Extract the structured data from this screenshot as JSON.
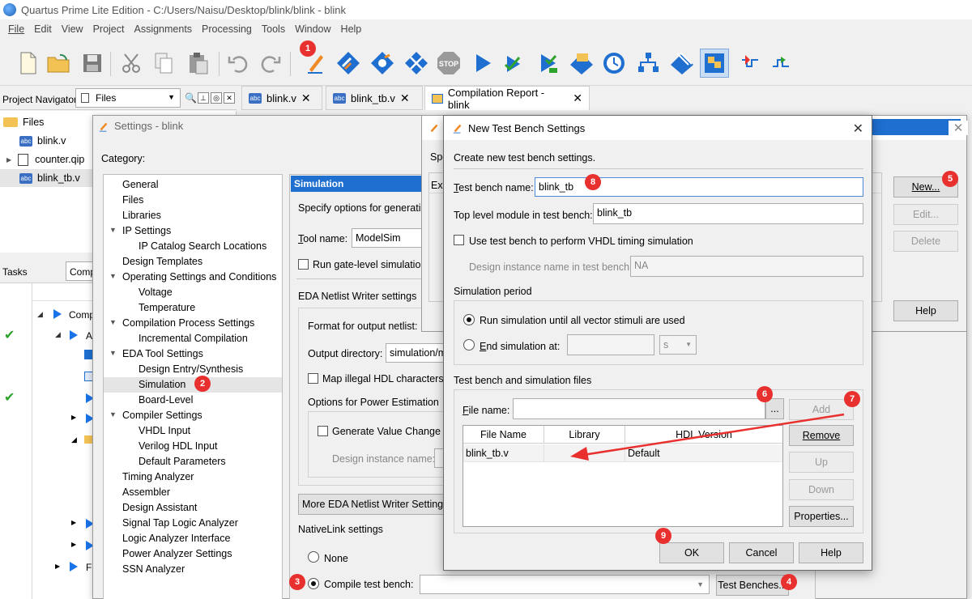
{
  "window": {
    "title": "Quartus Prime Lite Edition - C:/Users/Naisu/Desktop/blink/blink - blink"
  },
  "menu": [
    "File",
    "Edit",
    "View",
    "Project",
    "Assignments",
    "Processing",
    "Tools",
    "Window",
    "Help"
  ],
  "toolbar": {
    "icons": [
      "new-file-icon",
      "open-folder-icon",
      "save-icon",
      "cut-icon",
      "copy-icon",
      "paste-icon",
      "undo-icon",
      "redo-icon",
      "settings-pencil-icon",
      "analysis-icon",
      "compile-design-icon",
      "fitter-icon",
      "stop-icon",
      "start-icon",
      "check-icon",
      "start-analysis-icon",
      "assembler-icon",
      "timing-icon",
      "netlist-icon",
      "programmer-icon",
      "chip-planner-icon",
      "signal-tap-icon",
      "simulate-icon"
    ],
    "stop_label": "STOP"
  },
  "navigator": {
    "title": "Project Navigator",
    "view": "Files",
    "files": [
      {
        "name": "Files",
        "type": "folder"
      },
      {
        "name": "blink.v",
        "type": "abc"
      },
      {
        "name": "counter.qip",
        "type": "qip"
      },
      {
        "name": "blink_tb.v",
        "type": "abc"
      }
    ],
    "abc_label": "abc"
  },
  "tasks": {
    "label": "Tasks",
    "combo": "Comp",
    "rows": [
      "Comp",
      "A",
      "F"
    ]
  },
  "tabs": [
    {
      "label": "blink.v"
    },
    {
      "label": "blink_tb.v"
    },
    {
      "label": "Compilation Report - blink"
    }
  ],
  "settings": {
    "title": "Settings - blink",
    "category_label": "Category:",
    "categories": [
      "General",
      "Files",
      "Libraries",
      "IP Settings",
      "IP Catalog Search Locations",
      "Design Templates",
      "Operating Settings and Conditions",
      "Voltage",
      "Temperature",
      "Compilation Process Settings",
      "Incremental Compilation",
      "EDA Tool Settings",
      "Design Entry/Synthesis",
      "Simulation",
      "Board-Level",
      "Compiler Settings",
      "VHDL Input",
      "Verilog HDL Input",
      "Default Parameters",
      "Timing Analyzer",
      "Assembler",
      "Design Assistant",
      "Signal Tap Logic Analyzer",
      "Logic Analyzer Interface",
      "Power Analyzer Settings",
      "SSN Analyzer"
    ],
    "panel": {
      "header": "Simulation",
      "specify": "Specify options for generatin",
      "tool_name_label": "Tool name:",
      "tool_name": "ModelSim",
      "run_gate": "Run gate-level simulation",
      "eda_netlist": "EDA Netlist Writer settings",
      "format_label": "Format for output netlist:",
      "output_dir_label": "Output directory:",
      "output_dir": "simulation/m",
      "map_illegal": "Map illegal HDL characters",
      "power_est": "Options for Power Estimation",
      "gen_vcd": "Generate Value Change Du",
      "design_inst": "Design instance name:",
      "more_eda": "More EDA Netlist Writer Settings...",
      "nativelink": "NativeLink settings",
      "none": "None",
      "compile_tb": "Compile test bench:",
      "test_benches": "Test Benches..."
    }
  },
  "tb_list": {
    "spec": "Spe",
    "exi": "Exi",
    "new": "New...",
    "edit": "Edit...",
    "delete": "Delete",
    "help": "Help"
  },
  "ntb": {
    "title": "New Test Bench Settings",
    "intro": "Create new test bench settings.",
    "name_label": "Test bench name:",
    "name": "blink_tb",
    "top_label": "Top level module in test bench:",
    "top": "blink_tb",
    "vhdl_timing": "Use test bench to perform VHDL timing simulation",
    "design_inst_label": "Design instance name in test bench:",
    "design_inst": "NA",
    "sim_period": "Simulation period",
    "run_all": "Run simulation until all vector stimuli are used",
    "end_at": "End simulation at:",
    "unit": "s",
    "files_section": "Test bench and simulation files",
    "file_name_label": "File name:",
    "browse": "...",
    "add": "Add",
    "remove": "Remove",
    "up": "Up",
    "down": "Down",
    "properties": "Properties...",
    "columns": [
      "File Name",
      "Library",
      "HDL Version"
    ],
    "rows": [
      {
        "file": "blink_tb.v",
        "library": "",
        "hdl": "Default"
      }
    ],
    "ok": "OK",
    "cancel": "Cancel",
    "help": "Help"
  },
  "badges": [
    "1",
    "2",
    "3",
    "4",
    "5",
    "6",
    "7",
    "8",
    "9"
  ],
  "colors": {
    "accent": "#1e6fd0",
    "badge": "#e8302e",
    "arrow": "#e8302e"
  }
}
